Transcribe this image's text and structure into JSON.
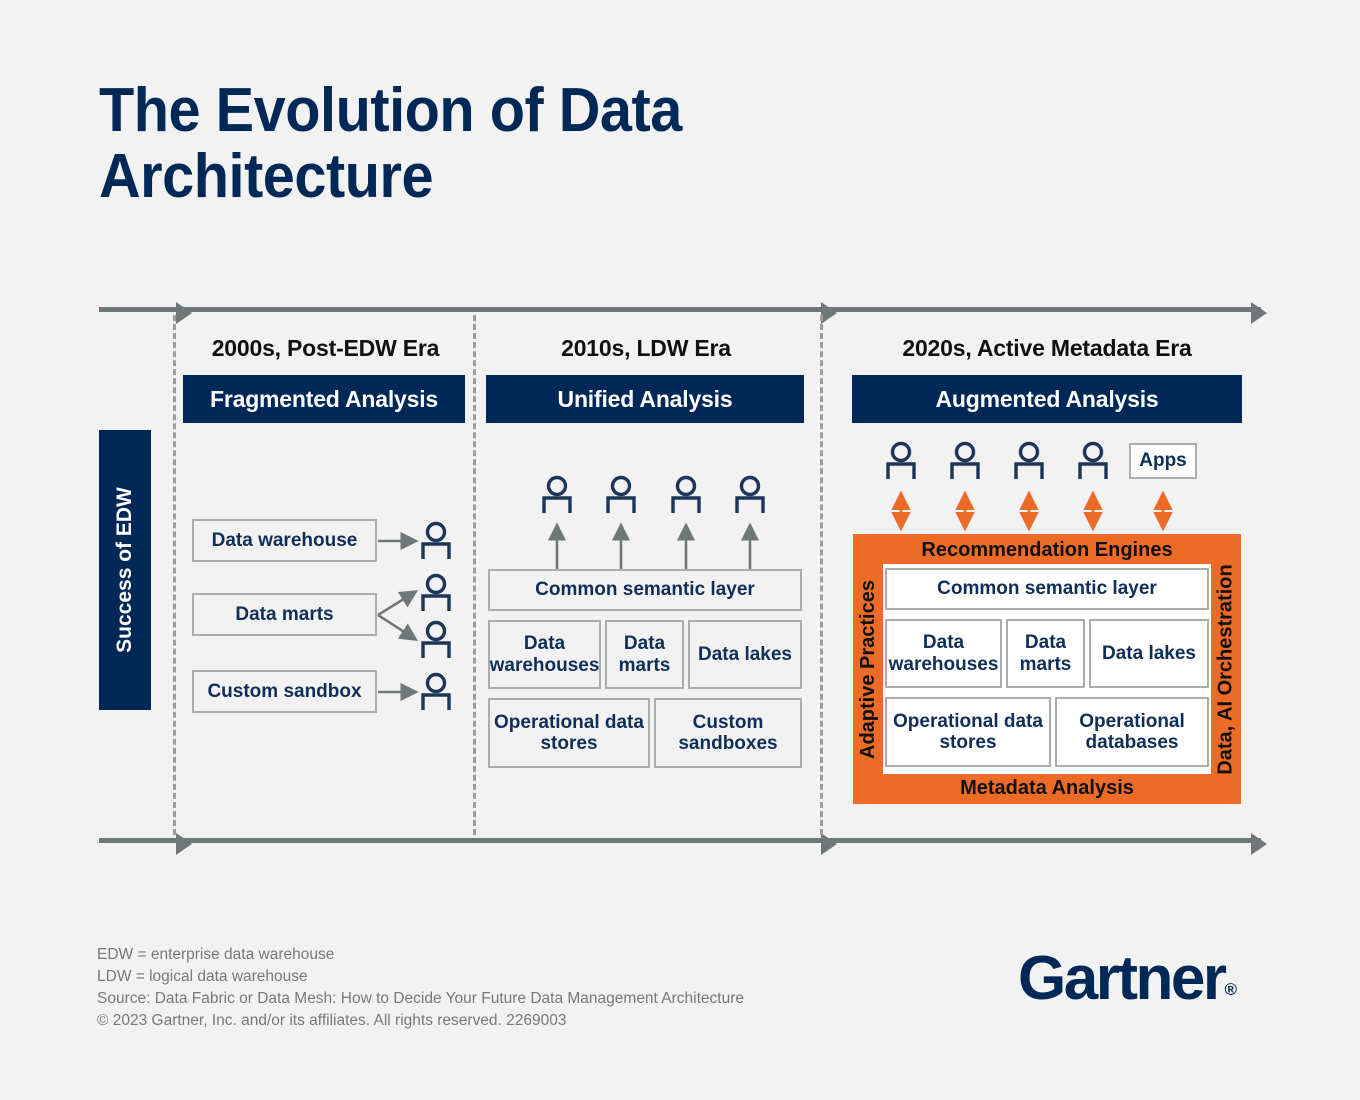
{
  "title": "The Evolution of Data\nArchitecture",
  "colors": {
    "navy": "#002857",
    "orange": "#EC6B26",
    "gray_line": "#6F7878",
    "box_border": "#A8AEAE",
    "background": "#F2F2F2"
  },
  "vertical_label": "Success of EDW",
  "eras": [
    {
      "name": "2000s, Post-EDW Era",
      "banner": "Fragmented Analysis",
      "nodes": [
        "Data warehouse",
        "Data marts",
        "Custom sandbox"
      ],
      "persons": 4
    },
    {
      "name": "2010s, LDW Era",
      "banner": "Unified Analysis",
      "persons": 4,
      "semantic_layer": "Common semantic layer",
      "row2": [
        "Data warehouses",
        "Data marts",
        "Data lakes"
      ],
      "row3": [
        "Operational data stores",
        "Custom sandboxes"
      ]
    },
    {
      "name": "2020s, Active Metadata Era",
      "banner": "Augmented Analysis",
      "persons": 4,
      "apps": "Apps",
      "panel_top": "Recommendation Engines",
      "panel_bottom": "Metadata Analysis",
      "panel_left": "Adaptive Practices",
      "panel_right": "Data, AI Orchestration",
      "semantic_layer": "Common semantic layer",
      "row2": [
        "Data warehouses",
        "Data marts",
        "Data lakes"
      ],
      "row3": [
        "Operational data stores",
        "Operational databases"
      ]
    }
  ],
  "footnotes": "EDW = enterprise data warehouse\nLDW = logical data warehouse\nSource: Data Fabric or Data Mesh: How to Decide Your Future Data Management Architecture\n© 2023 Gartner, Inc. and/or its affiliates. All rights reserved. 2269003",
  "logo": {
    "wordmark": "Gartner",
    "registered": "®"
  }
}
